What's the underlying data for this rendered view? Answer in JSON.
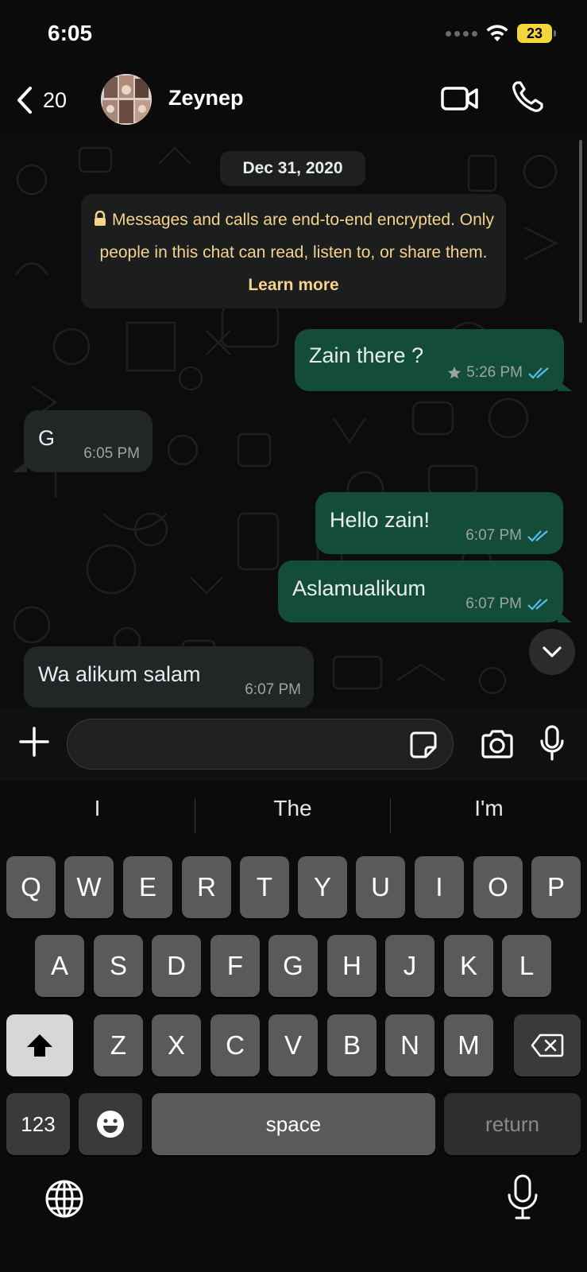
{
  "status_bar": {
    "time": "6:05",
    "battery": "23"
  },
  "header": {
    "back_count": "20",
    "contact_name": "Zeynep"
  },
  "chat": {
    "date_label": "Dec 31, 2020",
    "encryption_notice": {
      "text": "Messages and calls are end-to-end encrypted. Only people in this chat can read, listen to, or share them.",
      "link": "Learn more"
    },
    "messages": [
      {
        "direction": "out",
        "text": "Zain there ?",
        "time": "5:26 PM",
        "starred": true,
        "status": "read"
      },
      {
        "direction": "in",
        "text": "G",
        "time": "6:05 PM"
      },
      {
        "direction": "out",
        "text": "Hello zain!",
        "time": "6:07 PM",
        "status": "read"
      },
      {
        "direction": "out",
        "text": "Aslamualikum",
        "time": "6:07 PM",
        "status": "read"
      },
      {
        "direction": "in",
        "text": "Wa alikum salam",
        "time": "6:07 PM"
      }
    ]
  },
  "input": {
    "value": "",
    "placeholder": ""
  },
  "keyboard": {
    "suggestions": [
      "I",
      "The",
      "I'm"
    ],
    "row1": [
      "Q",
      "W",
      "E",
      "R",
      "T",
      "Y",
      "U",
      "I",
      "O",
      "P"
    ],
    "row2": [
      "A",
      "S",
      "D",
      "F",
      "G",
      "H",
      "J",
      "K",
      "L"
    ],
    "row3": [
      "Z",
      "X",
      "C",
      "V",
      "B",
      "N",
      "M"
    ],
    "numbers_label": "123",
    "space_label": "space",
    "return_label": "return"
  },
  "colors": {
    "outgoing_bubble": "#144d37",
    "incoming_bubble": "#232626",
    "read_ticks": "#53bdeb",
    "notice_text": "#f6d28d",
    "battery": "#f4d53b"
  },
  "icons": {
    "back": "chevron-left-icon",
    "video": "video-camera-icon",
    "call": "phone-icon",
    "plus": "plus-icon",
    "sticker": "sticker-icon",
    "camera": "camera-icon",
    "mic": "microphone-icon",
    "scroll_down": "chevron-down-icon",
    "globe": "globe-icon",
    "shift": "shift-arrow-icon",
    "backspace": "backspace-icon",
    "emoji": "emoji-icon"
  }
}
